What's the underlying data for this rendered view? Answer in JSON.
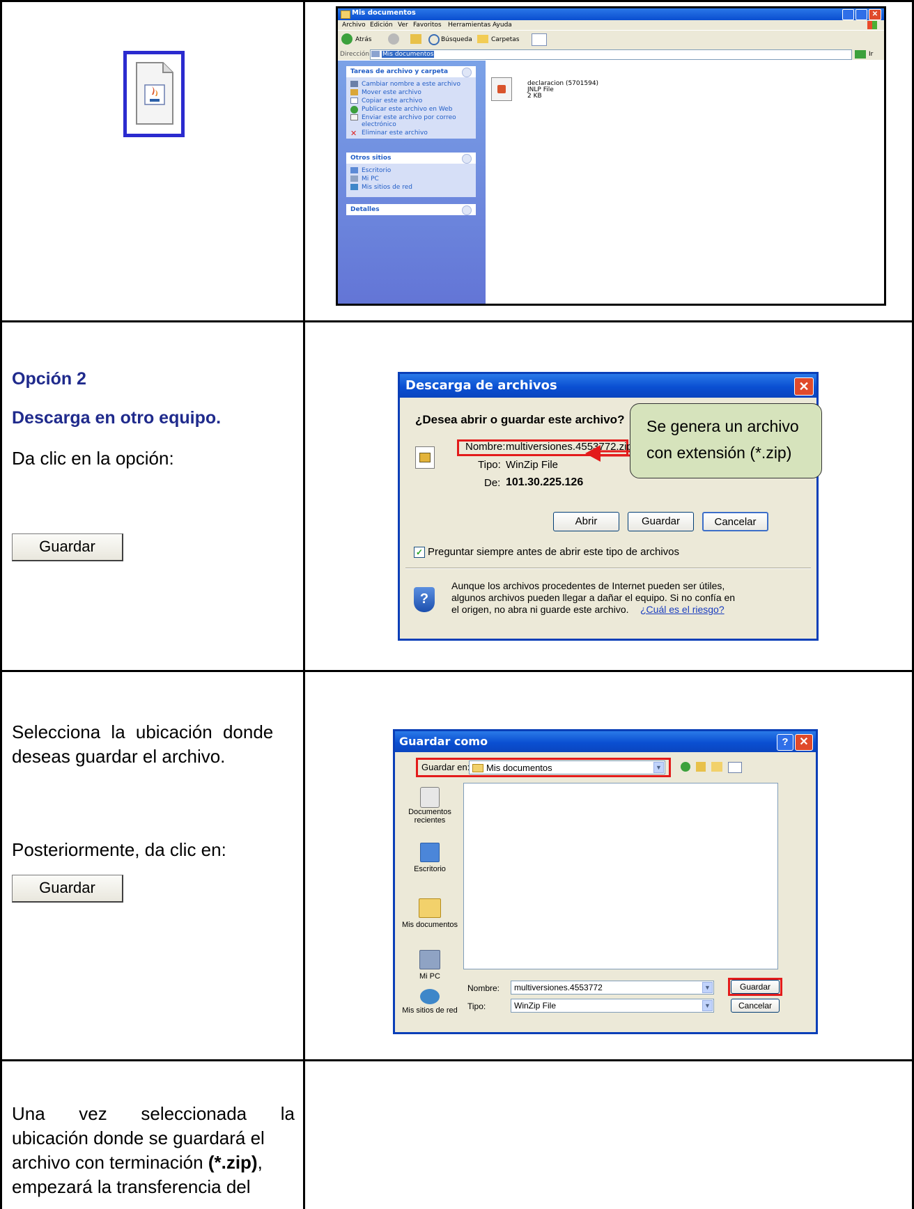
{
  "row1": {
    "explorer": {
      "title": "Mis documentos",
      "menu": [
        "Archivo",
        "Edición",
        "Ver",
        "Favoritos",
        "Herramientas",
        "Ayuda"
      ],
      "toolbar": {
        "back": "Atrás",
        "search": "Búsqueda",
        "folders": "Carpetas"
      },
      "address_label": "Dirección",
      "address_value": "Mis documentos",
      "go_label": "Ir",
      "tasks_header": "Tareas de archivo y carpeta",
      "tasks": [
        "Cambiar nombre a este archivo",
        "Mover este archivo",
        "Copiar este archivo",
        "Publicar este archivo en Web",
        "Enviar este archivo por correo",
        "electrónico",
        "Eliminar este archivo"
      ],
      "other_header": "Otros sitios",
      "other": [
        "Escritorio",
        "Mi PC",
        "Mis sitios de red"
      ],
      "details_header": "Detalles",
      "file_name": "declaracion (5701594)",
      "file_type": "JNLP File",
      "file_size": "2 KB"
    }
  },
  "row2": {
    "heading1": "Opción 2",
    "heading2": "Descarga en otro equipo.",
    "instruction": "Da clic en la opción:",
    "button_label": "Guardar",
    "dialog": {
      "title": "Descarga de archivos",
      "question": "¿Desea abrir o guardar este archivo?",
      "name_label": "Nombre:",
      "name_value": "multiversiones.4553772.zip",
      "type_label": "Tipo:",
      "type_value": "WinZip File",
      "from_label": "De:",
      "from_value": "101.30.225.126",
      "btn_open": "Abrir",
      "btn_save": "Guardar",
      "btn_cancel": "Cancelar",
      "checkbox_label": "Preguntar siempre antes de abrir este tipo de archivos",
      "warning_line1": "Aunque los archivos procedentes de Internet pueden ser útiles,",
      "warning_line2": "algunos archivos pueden llegar a dañar el equipo. Si no confía en",
      "warning_line3": "el origen, no abra ni guarde este archivo.",
      "risk_link": "¿Cuál es el riesgo?"
    },
    "callout_line1": "Se genera un archivo",
    "callout_line2": "con extensión (*.zip)"
  },
  "row3": {
    "text1_line1": "Selecciona la ubicación donde",
    "text1_line2": "deseas guardar el archivo.",
    "text2": "Posteriormente, da clic en:",
    "button_label": "Guardar",
    "dialog": {
      "title": "Guardar como",
      "save_in_label": "Guardar en:",
      "save_in_value": "Mis documentos",
      "places": [
        "Documentos recientes",
        "Escritorio",
        "Mis documentos",
        "Mi PC",
        "Mis sitios de red"
      ],
      "places_recent_l1": "Documentos",
      "places_recent_l2": "recientes",
      "name_label": "Nombre:",
      "name_value": "multiversiones.4553772",
      "type_label": "Tipo:",
      "type_value": "WinZip File",
      "btn_save": "Guardar",
      "btn_cancel": "Cancelar"
    }
  },
  "row4": {
    "line1_a": "Una",
    "line1_b": "vez",
    "line1_c": "seleccionada",
    "line1_d": "la",
    "line2": "ubicación donde se guardará el",
    "line3_a": "archivo con terminación ",
    "line3_b": "(*.zip)",
    "line3_c": ",",
    "line4": "empezará la transferencia del"
  }
}
